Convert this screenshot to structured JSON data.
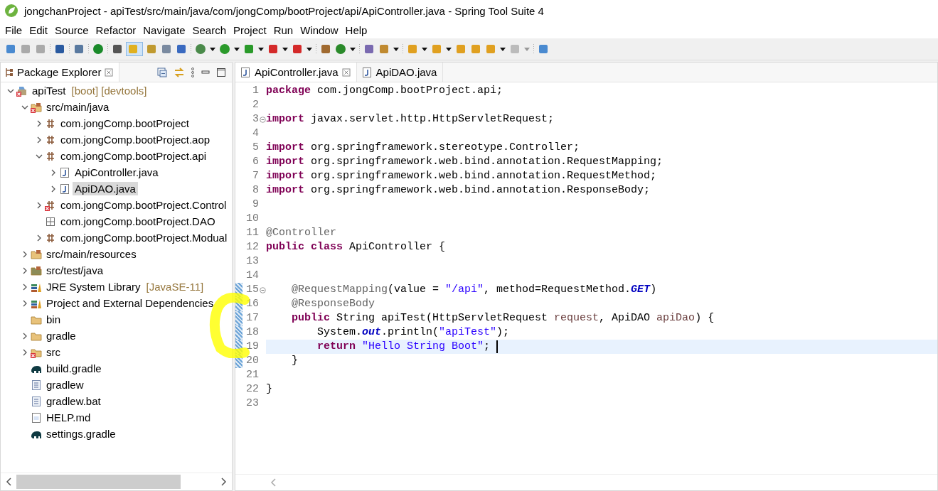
{
  "window": {
    "title": "jongchanProject - apiTest/src/main/java/com/jongComp/bootProject/api/ApiController.java - Spring Tool Suite 4"
  },
  "menu": [
    "File",
    "Edit",
    "Source",
    "Refactor",
    "Navigate",
    "Search",
    "Project",
    "Run",
    "Window",
    "Help"
  ],
  "explorer": {
    "title": "Package Explorer",
    "tree": [
      {
        "label": "apiTest",
        "decoration": "[boot] [devtools]",
        "kind": "project",
        "error": true,
        "expanded": true,
        "selected": false,
        "children": [
          {
            "label": "src/main/java",
            "kind": "source-folder",
            "error": true,
            "expanded": true,
            "selected": false,
            "children": [
              {
                "label": "com.jongComp.bootProject",
                "kind": "package",
                "error": false,
                "expanded": false,
                "selected": false
              },
              {
                "label": "com.jongComp.bootProject.aop",
                "kind": "package",
                "error": false,
                "expanded": false,
                "selected": false
              },
              {
                "label": "com.jongComp.bootProject.api",
                "kind": "package",
                "error": false,
                "expanded": true,
                "selected": false,
                "children": [
                  {
                    "label": "ApiController.java",
                    "kind": "java-file",
                    "error": false,
                    "expanded": false,
                    "selected": false
                  },
                  {
                    "label": "ApiDAO.java",
                    "kind": "java-file",
                    "error": false,
                    "expanded": false,
                    "selected": true
                  }
                ]
              },
              {
                "label": "com.jongComp.bootProject.Control",
                "kind": "package",
                "error": true,
                "expanded": false,
                "selected": false
              },
              {
                "label": "com.jongComp.bootProject.DAO",
                "kind": "empty-package",
                "error": false,
                "selected": false
              },
              {
                "label": "com.jongComp.bootProject.Modual",
                "kind": "package",
                "error": false,
                "expanded": false,
                "selected": false
              }
            ]
          },
          {
            "label": "src/main/resources",
            "kind": "resources-folder",
            "error": false,
            "expanded": false,
            "selected": false
          },
          {
            "label": "src/test/java",
            "kind": "test-folder",
            "error": false,
            "expanded": false,
            "selected": false
          },
          {
            "label": "JRE System Library",
            "decoration": "[JavaSE-11]",
            "kind": "library",
            "error": false,
            "expanded": false,
            "selected": false
          },
          {
            "label": "Project and External Dependencies",
            "kind": "library",
            "error": false,
            "expanded": false,
            "selected": false
          },
          {
            "label": "bin",
            "kind": "folder",
            "error": false,
            "selected": false
          },
          {
            "label": "gradle",
            "kind": "folder",
            "error": false,
            "expanded": false,
            "selected": false
          },
          {
            "label": "src",
            "kind": "folder",
            "error": true,
            "expanded": false,
            "selected": false
          },
          {
            "label": "build.gradle",
            "kind": "gradle-file",
            "error": false,
            "selected": false
          },
          {
            "label": "gradlew",
            "kind": "text-file",
            "error": false,
            "selected": false
          },
          {
            "label": "gradlew.bat",
            "kind": "text-file",
            "error": false,
            "selected": false
          },
          {
            "label": "HELP.md",
            "kind": "doc-file",
            "error": false,
            "selected": false
          },
          {
            "label": "settings.gradle",
            "kind": "gradle-file",
            "error": false,
            "selected": false
          }
        ]
      }
    ]
  },
  "editor": {
    "tabs": [
      {
        "label": "ApiController.java",
        "selected": true
      },
      {
        "label": "ApiDAO.java",
        "selected": false
      }
    ],
    "lines": [
      {
        "number": "1",
        "fold": false,
        "changed": false,
        "current": false,
        "tokens": [
          {
            "kind": "keyword",
            "text": "package"
          },
          {
            "kind": "plain",
            "text": " com.jongComp.bootProject.api;"
          }
        ]
      },
      {
        "number": "2",
        "fold": false,
        "changed": false,
        "current": false
      },
      {
        "number": "3",
        "fold": true,
        "changed": false,
        "current": false,
        "tokens": [
          {
            "kind": "keyword",
            "text": "import"
          },
          {
            "kind": "plain",
            "text": " javax.servlet.http.HttpServletRequest;"
          }
        ]
      },
      {
        "number": "4",
        "fold": false,
        "changed": false,
        "current": false
      },
      {
        "number": "5",
        "fold": false,
        "changed": false,
        "current": false,
        "tokens": [
          {
            "kind": "keyword",
            "text": "import"
          },
          {
            "kind": "plain",
            "text": " org.springframework.stereotype.Controller;"
          }
        ]
      },
      {
        "number": "6",
        "fold": false,
        "changed": false,
        "current": false,
        "tokens": [
          {
            "kind": "keyword",
            "text": "import"
          },
          {
            "kind": "plain",
            "text": " org.springframework.web.bind.annotation.RequestMapping;"
          }
        ]
      },
      {
        "number": "7",
        "fold": false,
        "changed": false,
        "current": false,
        "tokens": [
          {
            "kind": "keyword",
            "text": "import"
          },
          {
            "kind": "plain",
            "text": " org.springframework.web.bind.annotation.RequestMethod;"
          }
        ]
      },
      {
        "number": "8",
        "fold": false,
        "changed": false,
        "current": false,
        "tokens": [
          {
            "kind": "keyword",
            "text": "import"
          },
          {
            "kind": "plain",
            "text": " org.springframework.web.bind.annotation.ResponseBody;"
          }
        ]
      },
      {
        "number": "9",
        "fold": false,
        "changed": false,
        "current": false
      },
      {
        "number": "10",
        "fold": false,
        "changed": false,
        "current": false
      },
      {
        "number": "11",
        "fold": false,
        "changed": false,
        "current": false,
        "tokens": [
          {
            "kind": "annotation",
            "text": "@Controller"
          }
        ]
      },
      {
        "number": "12",
        "fold": false,
        "changed": false,
        "current": false,
        "tokens": [
          {
            "kind": "keyword",
            "text": "public"
          },
          {
            "kind": "keyword",
            "text": " class"
          },
          {
            "kind": "plain",
            "text": " ApiController {"
          }
        ]
      },
      {
        "number": "13",
        "fold": false,
        "changed": false,
        "current": false
      },
      {
        "number": "14",
        "fold": false,
        "changed": false,
        "current": false
      },
      {
        "number": "15",
        "fold": true,
        "changed": true,
        "current": false,
        "tokens": [
          {
            "kind": "annotation",
            "text": "    @RequestMapping"
          },
          {
            "kind": "plain",
            "text": "(value = "
          },
          {
            "kind": "string",
            "text": "\"/api\""
          },
          {
            "kind": "plain",
            "text": ", method=RequestMethod."
          },
          {
            "kind": "constant",
            "text": "GET"
          },
          {
            "kind": "plain",
            "text": ")"
          }
        ]
      },
      {
        "number": "16",
        "fold": false,
        "changed": true,
        "current": false,
        "tokens": [
          {
            "kind": "annotation",
            "text": "    @ResponseBody"
          }
        ]
      },
      {
        "number": "17",
        "fold": false,
        "changed": true,
        "current": false,
        "tokens": [
          {
            "kind": "keyword",
            "text": "    public"
          },
          {
            "kind": "plain",
            "text": " String apiTest(HttpServletRequest "
          },
          {
            "kind": "parameter",
            "text": "request"
          },
          {
            "kind": "plain",
            "text": ", ApiDAO "
          },
          {
            "kind": "parameter",
            "text": "apiDao"
          },
          {
            "kind": "plain",
            "text": ") {"
          }
        ]
      },
      {
        "number": "18",
        "fold": false,
        "changed": true,
        "current": false,
        "tokens": [
          {
            "kind": "plain",
            "text": "        System."
          },
          {
            "kind": "constant",
            "text": "out"
          },
          {
            "kind": "plain",
            "text": ".println("
          },
          {
            "kind": "string",
            "text": "\"apiTest\""
          },
          {
            "kind": "plain",
            "text": ");"
          }
        ]
      },
      {
        "number": "19",
        "fold": false,
        "changed": true,
        "current": true,
        "tokens": [
          {
            "kind": "keyword",
            "text": "        return"
          },
          {
            "kind": "string",
            "text": " \"Hello String Boot\""
          },
          {
            "kind": "plain",
            "text": ";"
          }
        ]
      },
      {
        "number": "20",
        "fold": false,
        "changed": true,
        "current": false,
        "tokens": [
          {
            "kind": "plain",
            "text": "    }"
          }
        ]
      },
      {
        "number": "21",
        "fold": false,
        "changed": false,
        "current": false
      },
      {
        "number": "22",
        "fold": false,
        "changed": false,
        "current": false,
        "tokens": [
          {
            "kind": "plain",
            "text": "}"
          }
        ]
      },
      {
        "number": "23",
        "fold": false,
        "changed": false,
        "current": false
      }
    ]
  }
}
